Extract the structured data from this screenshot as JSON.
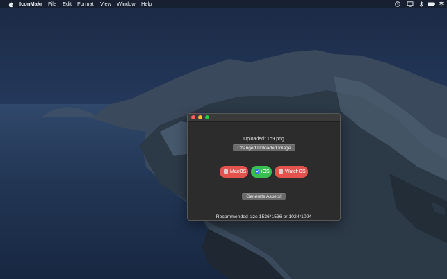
{
  "menubar": {
    "app_name": "IconMakr",
    "items": [
      "File",
      "Edit",
      "Format",
      "View",
      "Window",
      "Help"
    ],
    "status_icons": [
      "time-machine-icon",
      "airplay-icon",
      "bluetooth-icon",
      "battery-icon",
      "wifi-icon"
    ]
  },
  "window": {
    "uploaded_label": "Uploaded: 1c9.png",
    "change_button": "Changed Uploaded Image",
    "toggles": [
      {
        "label": "MacOS",
        "checked": false,
        "color": "#e2534e"
      },
      {
        "label": "iOS",
        "checked": true,
        "color": "#3cbd51"
      },
      {
        "label": "WatchOS",
        "checked": false,
        "color": "#e2534e"
      }
    ],
    "generate_button": "Generate Assets!",
    "recommend_text": "Recommended size 1536*1536 or 1024*1024"
  },
  "colors": {
    "close": "#f55f57",
    "minimize": "#f6bd2f",
    "maximize": "#2ac742",
    "window_bg": "#2c2c2c"
  }
}
